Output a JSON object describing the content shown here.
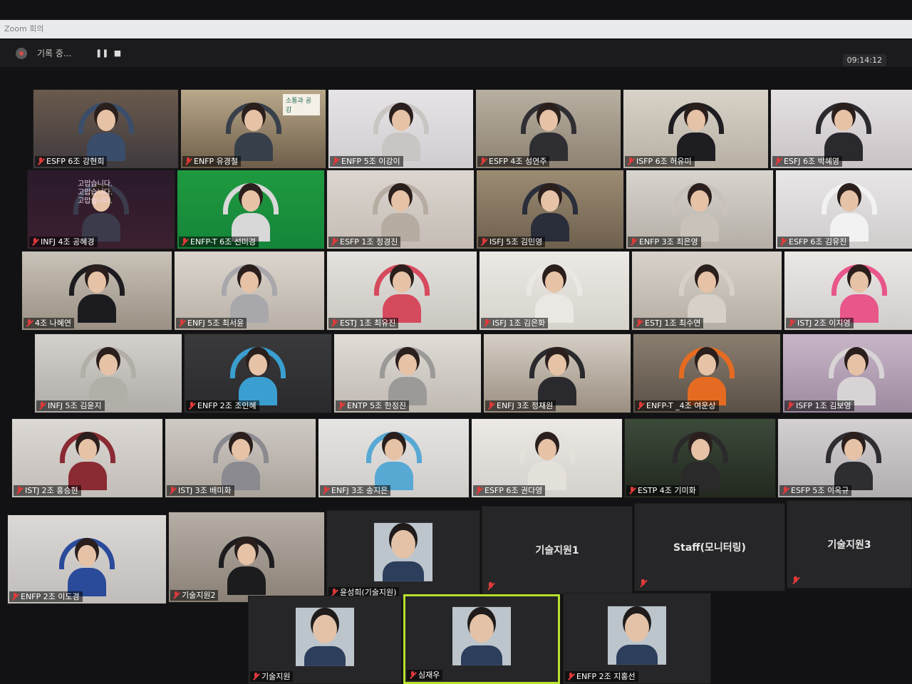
{
  "window": {
    "title": "Zoom 회의"
  },
  "recording": {
    "label": "기록 중...",
    "pause_icon": "pause-icon",
    "stop_icon": "stop-icon"
  },
  "clock": "09:14:12",
  "participants": [
    {
      "name": "ESFP 6조 강현희",
      "bg1": "#6b5a4c",
      "bg2": "#3f3a3e",
      "shirt": "#3a4d6a"
    },
    {
      "name": "ENFP 유경철",
      "bg1": "#b9a88a",
      "bg2": "#6e5e4a",
      "shirt": "#37404a"
    },
    {
      "name": "ENFP 5조 이강이",
      "bg1": "#e6e4e6",
      "bg2": "#cfcdd0",
      "shirt": "#c9c5c2"
    },
    {
      "name": "ESFP 4조 성연주",
      "bg1": "#b8b0a2",
      "bg2": "#8e8272",
      "shirt": "#2f2f33"
    },
    {
      "name": "ISFP 6조 허유미",
      "bg1": "#d8d2c8",
      "bg2": "#b8b0a4",
      "shirt": "#1e1e22"
    },
    {
      "name": "ESFJ 6조 박혜영",
      "bg1": "#e6e2e4",
      "bg2": "#c8c2c4",
      "shirt": "#2a2a2e"
    },
    {
      "name": "INFJ 4조 공혜경",
      "bg1": "#2a1a2a",
      "bg2": "#3c2030",
      "shirt": "#3b3b4c"
    },
    {
      "name": "ENFP-T 6조 선미경",
      "bg1": "#1f9a3f",
      "bg2": "#15853a",
      "shirt": "#d8d8d8"
    },
    {
      "name": "ESFP 1조 정경진",
      "bg1": "#dcd6d0",
      "bg2": "#c4bcb4",
      "shirt": "#b6aca2"
    },
    {
      "name": "ISFJ 5조 김민영",
      "bg1": "#9c8c74",
      "bg2": "#6e604e",
      "shirt": "#2a2e3a"
    },
    {
      "name": "ENFP 3조 최은영",
      "bg1": "#d8d4ce",
      "bg2": "#b4aea6",
      "shirt": "#c8c2ba"
    },
    {
      "name": "ESFP 6조 김유진",
      "bg1": "#e8e6e6",
      "bg2": "#cfcccc",
      "shirt": "#f2f2f2"
    },
    {
      "name": "4조 나혜연",
      "bg1": "#c9c2b8",
      "bg2": "#9a9084",
      "shirt": "#1c1c20"
    },
    {
      "name": "ENFJ 5조 최서윤",
      "bg1": "#ddd6ce",
      "bg2": "#b8b0a6",
      "shirt": "#a8a8ac"
    },
    {
      "name": "ESTJ 1조 최유진",
      "bg1": "#e4e2de",
      "bg2": "#cac6c0",
      "shirt": "#d64a5e"
    },
    {
      "name": "ISFJ 1조 김은화",
      "bg1": "#ece9e4",
      "bg2": "#d6d2cc",
      "shirt": "#ebe8e4"
    },
    {
      "name": "ESTJ 1조 최수연",
      "bg1": "#d8d2ca",
      "bg2": "#b6aea4",
      "shirt": "#d6d0c8"
    },
    {
      "name": "ISTJ 2조 이지영",
      "bg1": "#ece8e6",
      "bg2": "#d0ccca",
      "shirt": "#e8568a"
    },
    {
      "name": "INFJ 5조 김윤지",
      "bg1": "#d4d0cc",
      "bg2": "#b0aca8",
      "shirt": "#b2aea8"
    },
    {
      "name": "ENFP 2조 조인혜",
      "bg1": "#3a3a3c",
      "bg2": "#2a2a2c",
      "shirt": "#3a9fd0"
    },
    {
      "name": "ENTP 5조 한정진",
      "bg1": "#e0dcd6",
      "bg2": "#bfb9b2",
      "shirt": "#9c9a98"
    },
    {
      "name": "ENFJ 3조 정채원",
      "bg1": "#d6cfc6",
      "bg2": "#9a8e80",
      "shirt": "#2a2a2e"
    },
    {
      "name": "ENFP-T _4조 여운상",
      "bg1": "#8a7e70",
      "bg2": "#5a5046",
      "shirt": "#e66b22"
    },
    {
      "name": "ISFP 1조 김보영",
      "bg1": "#c8b6c8",
      "bg2": "#9e8aa0",
      "shirt": "#d8d4d6"
    },
    {
      "name": "ISTJ 2조 홍승현",
      "bg1": "#dcd8d4",
      "bg2": "#c2bdb8",
      "shirt": "#8a2a32"
    },
    {
      "name": "ISTJ 3조 배미화",
      "bg1": "#d0cac4",
      "bg2": "#aaa39c",
      "shirt": "#8a8a90"
    },
    {
      "name": "ENFJ 3조 송지은",
      "bg1": "#e6e4e2",
      "bg2": "#cfccca",
      "shirt": "#58a8d4"
    },
    {
      "name": "ESFP 6조 권다영",
      "bg1": "#ece9e6",
      "bg2": "#d4d0cc",
      "shirt": "#e4e0da"
    },
    {
      "name": "ESTP 4조 기미화",
      "bg1": "#3c4a3a",
      "bg2": "#22281f",
      "shirt": "#2a2a2a"
    },
    {
      "name": "ESFP 5조 이옥규",
      "bg1": "#d4d0d2",
      "bg2": "#b2aeb0",
      "shirt": "#2e2e32"
    },
    {
      "name": "ENFP 2조 이도경",
      "bg1": "#dcd8d6",
      "bg2": "#c0bcba",
      "shirt": "#2a4a9a"
    },
    {
      "name": "기술지원2",
      "bg1": "#b6aea6",
      "bg2": "#8a8076",
      "shirt": "#1c1c1e"
    }
  ],
  "blank_tiles": [
    {
      "name": "기술지원1"
    },
    {
      "name": "Staff(모니터링)"
    },
    {
      "name": "기술지원3"
    }
  ],
  "photo_tiles": [
    {
      "name": "윤성희(기술지원)"
    },
    {
      "name": "기술지원"
    },
    {
      "name": "심재우"
    },
    {
      "name": "ENFP 2조 지홍선"
    }
  ],
  "wall_sign": [
    "고맙습니다.",
    "고맙습니다.",
    "고맙습니다."
  ],
  "book_sign": "소통과 공감"
}
